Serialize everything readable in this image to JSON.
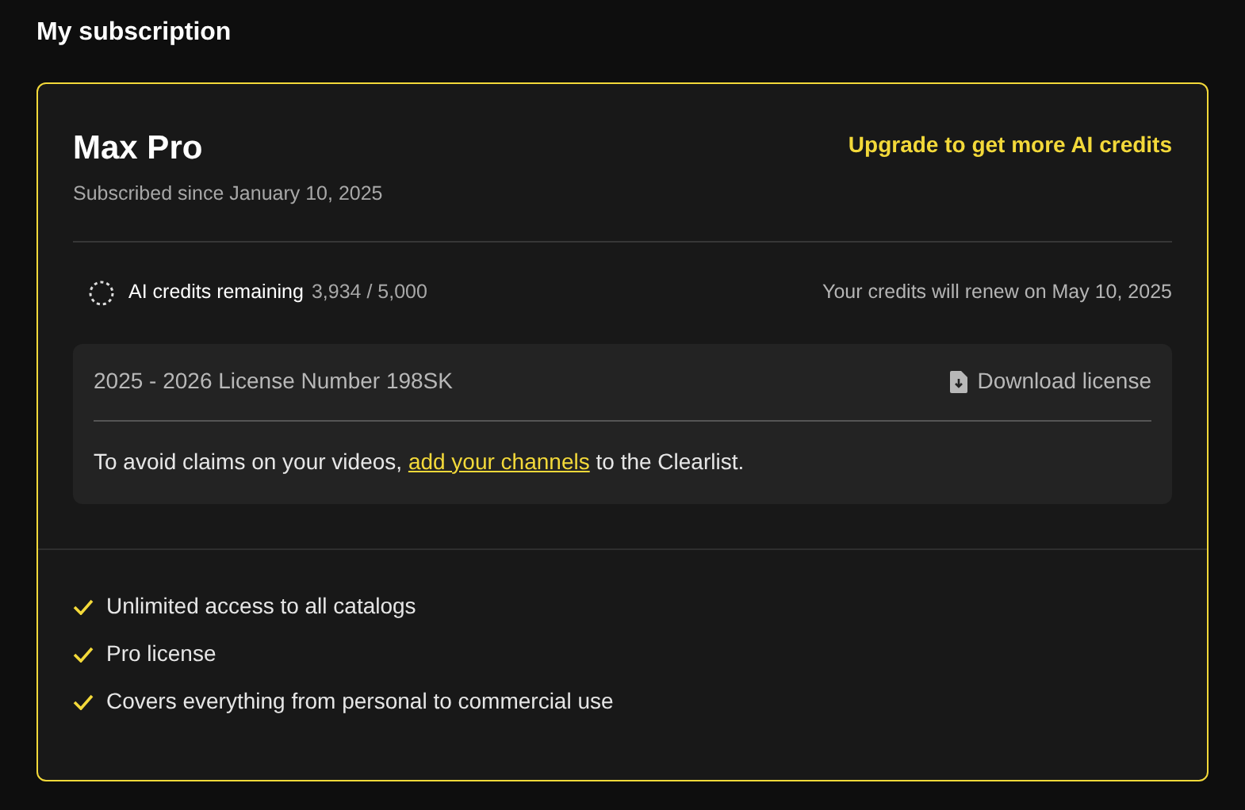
{
  "heading": "My subscription",
  "plan": {
    "name": "Max Pro",
    "since": "Subscribed since January 10, 2025",
    "upgrade": "Upgrade to get more AI credits"
  },
  "credits": {
    "label": "AI credits remaining",
    "count": "3,934 / 5,000",
    "renew": "Your credits will renew on May 10, 2025"
  },
  "license": {
    "number": "2025 - 2026 License Number 198SK",
    "download": "Download license",
    "notice_before": "To avoid claims on your videos, ",
    "notice_link": "add your channels",
    "notice_after": " to the Clearlist."
  },
  "features": [
    "Unlimited access to all catalogs",
    "Pro license",
    "Covers everything from personal to commercial use"
  ]
}
